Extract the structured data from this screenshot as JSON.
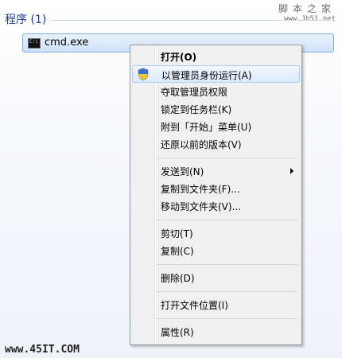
{
  "section": {
    "title": "程序 (1)"
  },
  "watermark_top": {
    "chars": "脚本之家",
    "url": "www.Jb51.net"
  },
  "result": {
    "icon_text": "C:\\",
    "label": "cmd.exe"
  },
  "menu": {
    "items": [
      {
        "label": "打开(O)"
      },
      {
        "label": "以管理员身份运行(A)"
      },
      {
        "label": "夺取管理员权限"
      },
      {
        "label": "锁定到任务栏(K)"
      },
      {
        "label": "附到「开始」菜单(U)"
      },
      {
        "label": "还原以前的版本(V)"
      },
      {
        "label": "发送到(N)"
      },
      {
        "label": "复制到文件夹(F)..."
      },
      {
        "label": "移动到文件夹(V)..."
      },
      {
        "label": "剪切(T)"
      },
      {
        "label": "复制(C)"
      },
      {
        "label": "删除(D)"
      },
      {
        "label": "打开文件位置(I)"
      },
      {
        "label": "属性(R)"
      }
    ]
  },
  "watermark_bottom": {
    "text": "www.45IT.COM"
  },
  "colors": {
    "accent": "#1e3d8f",
    "highlight": "#dbeafc"
  }
}
